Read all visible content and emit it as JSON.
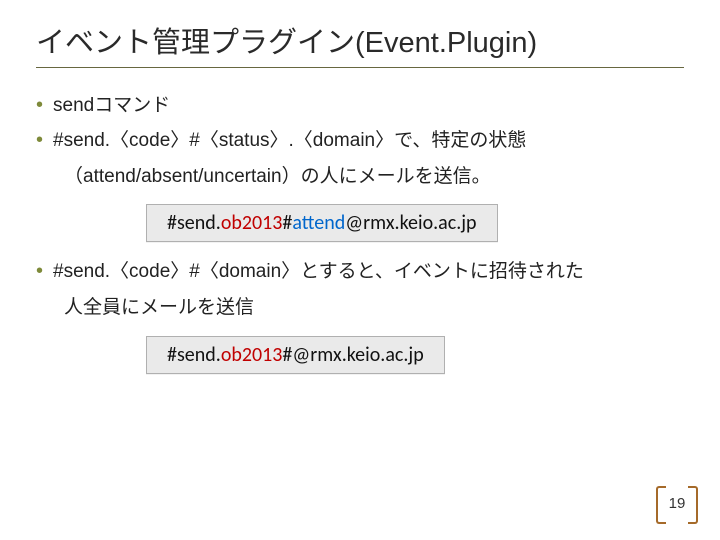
{
  "title": "イベント管理プラグイン(Event.Plugin)",
  "bullets": {
    "b1": "sendコマンド",
    "b2": "#send.〈code〉#〈status〉.〈domain〉で、特定の状態",
    "b2c": "（attend/absent/uncertain）の人にメールを送信。",
    "b3": "#send.〈code〉#〈domain〉とすると、イベントに招待された",
    "b3c": "人全員にメールを送信"
  },
  "code1": {
    "a": "#send.",
    "b": "ob2013",
    "c": "#",
    "d": "attend",
    "e": "@rmx.keio.ac.jp"
  },
  "code2": {
    "a": "#send.",
    "b": "ob2013",
    "c": "#@rmx.keio.ac.jp"
  },
  "page": "19"
}
